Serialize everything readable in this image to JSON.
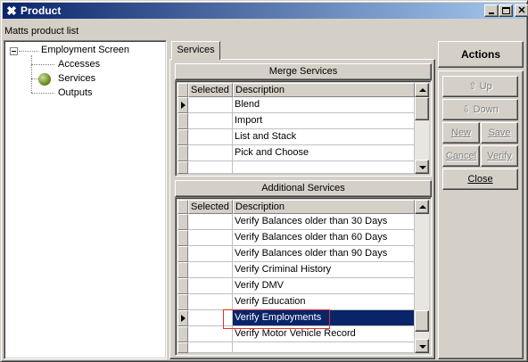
{
  "window": {
    "title": "Product",
    "icon": "x-icon",
    "controls": {
      "minimize": "minimize",
      "maximize": "maximize",
      "close": "✕"
    }
  },
  "product_label": "Matts product list",
  "tree": {
    "root": "Employment Screen",
    "children": [
      "Accesses",
      "Services",
      "Outputs"
    ],
    "selected": "Services"
  },
  "tabs": [
    "Services"
  ],
  "merge_services": {
    "header": "Merge Services",
    "columns": [
      "Selected",
      "Description"
    ],
    "rows": [
      {
        "selected": "",
        "description": "Blend"
      },
      {
        "selected": "",
        "description": "Import"
      },
      {
        "selected": "",
        "description": "List and Stack"
      },
      {
        "selected": "",
        "description": "Pick and Choose"
      }
    ]
  },
  "additional_services": {
    "header": "Additional Services",
    "columns": [
      "Selected",
      "Description"
    ],
    "rows": [
      {
        "selected": "",
        "description": "Verify Balances older than 30 Days"
      },
      {
        "selected": "",
        "description": "Verify Balances older than 60 Days"
      },
      {
        "selected": "",
        "description": "Verify Balances older than 90 Days"
      },
      {
        "selected": "",
        "description": "Verify Criminal History"
      },
      {
        "selected": "",
        "description": "Verify DMV"
      },
      {
        "selected": "",
        "description": "Verify Education"
      },
      {
        "selected": "",
        "description": "Verify Employments"
      },
      {
        "selected": "",
        "description": "Verify Motor Vehicle Record"
      }
    ],
    "selected_row": "Verify Employments"
  },
  "actions": {
    "title": "Actions",
    "up": "Up",
    "down": "Down",
    "new": "New",
    "save": "Save",
    "cancel": "Cancel",
    "verify": "Verify",
    "close": "Close"
  },
  "colors": {
    "titlebar_start": "#0a246a",
    "titlebar_end": "#a6caf0",
    "selection": "#0a246a",
    "highlight_outline": "#e03030"
  }
}
